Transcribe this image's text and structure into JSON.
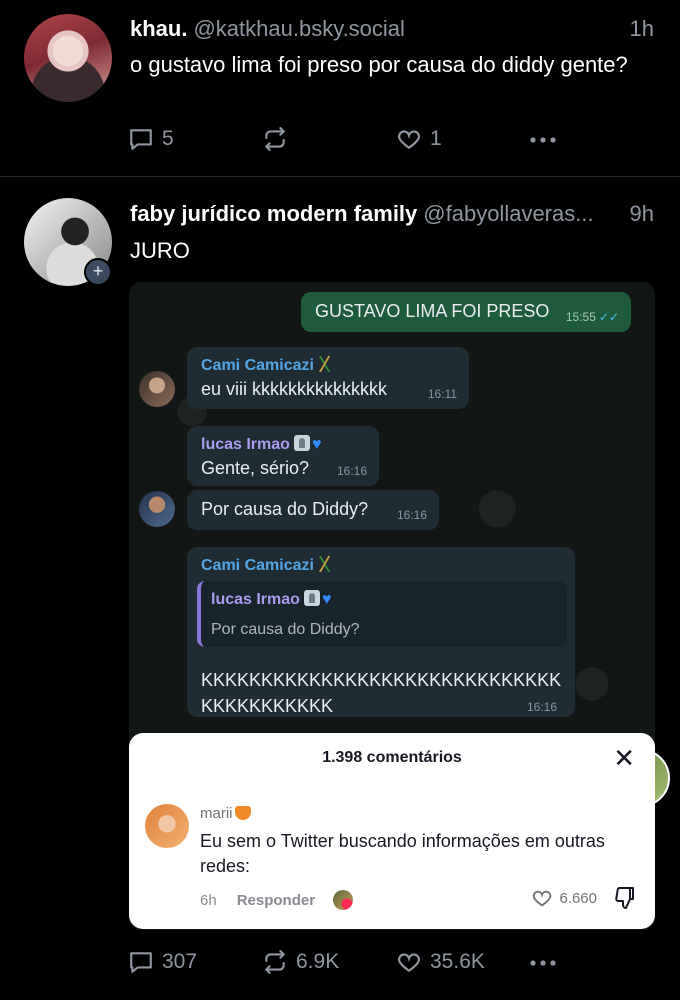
{
  "post1": {
    "name": "khau.",
    "handle": "@katkhau.bsky.social",
    "time": "1h",
    "text": "o gustavo lima foi preso por causa do diddy gente?",
    "replies": "5",
    "reposts": "",
    "likes": "1"
  },
  "post2": {
    "name": "faby jurídico modern family",
    "handle": "@fabyollaveras...",
    "time": "9h",
    "text": "JURO",
    "replies": "307",
    "reposts": "6.9K",
    "likes": "35.6K",
    "follow_symbol": "+"
  },
  "chat": {
    "outgoing_text": "GUSTAVO LIMA FOI PRESO",
    "outgoing_time": "15:55",
    "m1_sender": "Cami Camicazi",
    "m1_text": "eu viii kkkkkkkkkkkkkkk",
    "m1_time": "16:11",
    "m2_sender": "lucas Irmao",
    "m2_text": "Gente, sério?",
    "m2_time": "16:16",
    "m3_text": "Por causa do Diddy?",
    "m3_time": "16:16",
    "m4_sender": "Cami Camicazi",
    "m4_quote_sender": "lucas Irmao",
    "m4_quote_text": "Por causa do Diddy?",
    "m4_text_line1": "KKKKKKKKKKKKKKKKKKKKKKKKKKKKKK",
    "m4_text_line2": "KKKKKKKKKKK",
    "m4_time": "16:16",
    "sender1_color": "#53a6e6",
    "sender2_color": "#a99cf0"
  },
  "comment_card": {
    "title": "1.398 comentários",
    "close": "✕",
    "user": "marii",
    "text": "Eu sem o Twitter buscando informações em outras redes:",
    "age": "6h",
    "reply_label": "Responder",
    "likes": "6.660"
  },
  "icons": {
    "reply": "speech-bubble-icon",
    "repost": "repost-icon",
    "like": "heart-icon",
    "more": "more-dots-icon",
    "dislike": "thumbs-down-icon",
    "close": "close-icon"
  }
}
